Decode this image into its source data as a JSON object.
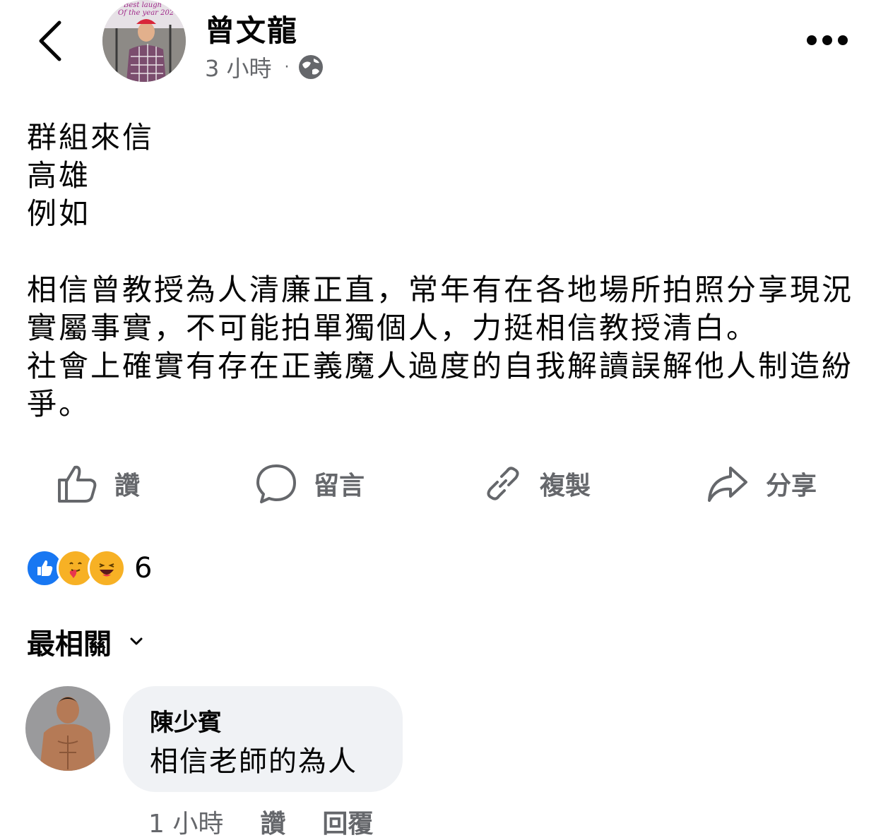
{
  "post": {
    "author": "曾文龍",
    "time": "3 小時",
    "separator": "·",
    "privacy_icon": "globe-icon",
    "avatar_text": "Best laugh Of the year 202",
    "body": {
      "line1": "群組來信",
      "line2": "高雄",
      "line3": "例如",
      "para1": "相信曾教授為人清廉正直，常年有在各地場所拍照分享現況實屬事實，不可能拍單獨個人，力挺相信教授清白。",
      "para2": "社會上確實有存在正義魔人過度的自我解讀誤解他人制造紛爭。"
    }
  },
  "actions": {
    "like": "讚",
    "comment": "留言",
    "copy": "複製",
    "share": "分享"
  },
  "reactions": {
    "count": "6",
    "types": [
      "like-icon",
      "care-icon",
      "haha-icon"
    ],
    "colors": {
      "like": "#1877f2",
      "care": "#f7b125",
      "haha": "#f7b125"
    }
  },
  "comments_sort": {
    "label": "最相關"
  },
  "comment": {
    "name": "陳少賓",
    "text": "相信老師的為人",
    "time": "1 小時",
    "like": "讚",
    "reply": "回覆"
  },
  "colors": {
    "text": "#050505",
    "secondary": "#65676b",
    "bubble": "#f0f2f5",
    "accent": "#1877f2"
  }
}
